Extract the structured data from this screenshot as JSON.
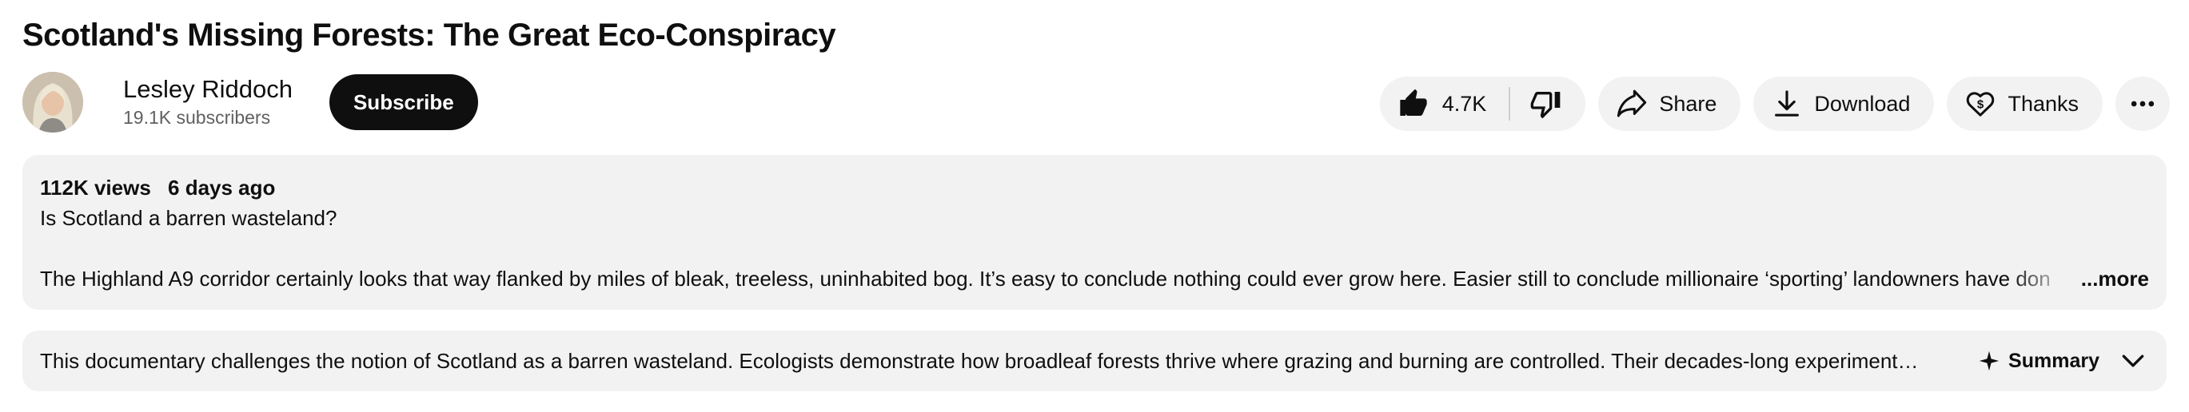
{
  "video": {
    "title": "Scotland's Missing Forests: The Great Eco-Conspiracy"
  },
  "channel": {
    "name": "Lesley Riddoch",
    "subscribers": "19.1K subscribers",
    "subscribe_label": "Subscribe"
  },
  "actions": {
    "like_count": "4.7K",
    "share_label": "Share",
    "download_label": "Download",
    "thanks_label": "Thanks",
    "icons": [
      "thumbs-up-icon",
      "thumbs-down-icon",
      "share-icon",
      "download-icon",
      "thanks-icon",
      "more-options-icon"
    ]
  },
  "description": {
    "views": "112K views",
    "age": "6 days ago",
    "line1": "Is Scotland a barren wasteland?",
    "line2": "The Highland A9 corridor certainly looks that way flanked by miles of bleak, treeless, uninhabited bog. It’s easy to conclude nothing could ever grow here. Easier still to conclude millionaire ‘sporting’ landowners have don",
    "more_label": "...more"
  },
  "summary": {
    "text": "This documentary challenges the notion of Scotland as a barren wasteland. Ecologists demonstrate how broadleaf forests thrive where grazing and burning are controlled. Their decades-long experiment…",
    "button_label": "Summary"
  },
  "colors": {
    "background": "#ffffff",
    "pill": "#f2f2f2",
    "subscribe": "#0f0f0f",
    "secondary_text": "#606060"
  }
}
